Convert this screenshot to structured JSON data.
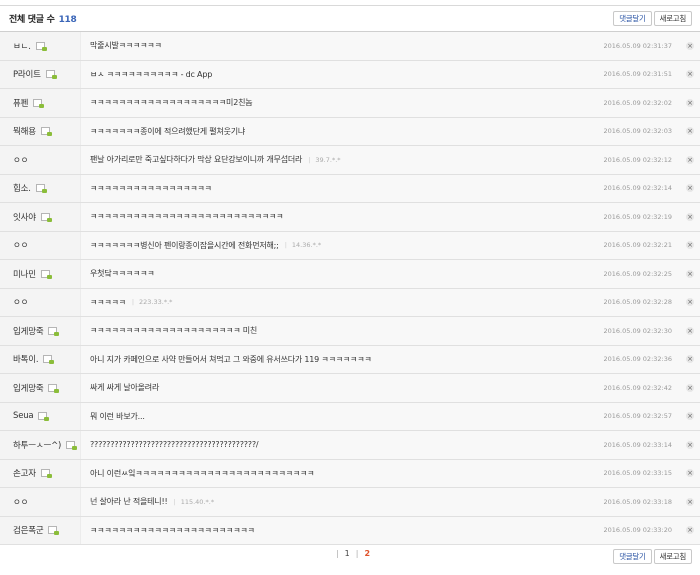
{
  "header": {
    "title": "전체 댓글 수",
    "count": "118",
    "write_button": "댓글달기",
    "refresh_button": "새로고침"
  },
  "comments": [
    {
      "nick": "ㅂㄴ.",
      "text": "막줄시발ㅋㅋㅋㅋㅋㅋ",
      "ip": "",
      "date": "2016.05.09 02:31:37"
    },
    {
      "nick": "P라이트",
      "text": "ㅂㅅ ㅋㅋㅋㅋㅋㅋㅋㅋㅋㅋ - dc App",
      "ip": "",
      "date": "2016.05.09 02:31:51"
    },
    {
      "nick": "퓨펜",
      "text": "ㅋㅋㅋㅋㅋㅋㅋㅋㅋㅋㅋㅋㅋㅋㅋㅋㅋㅋㅋ미2친놈",
      "ip": "",
      "date": "2016.05.09 02:32:02"
    },
    {
      "nick": "뭑해용",
      "text": "ㅋㅋㅋㅋㅋㅋㅋ종이에 적으려했단게 펼쳐웃기냐",
      "ip": "",
      "date": "2016.05.09 02:32:03"
    },
    {
      "nick": "ㅇㅇ",
      "text": "팬날 아가리로만 죽고싶다하다가 막상 요단강보이니까 개무섭더라",
      "ip": "39.7.*.*",
      "date": "2016.05.09 02:32:12"
    },
    {
      "nick": "힙소.",
      "text": "ㅋㅋㅋㅋㅋㅋㅋㅋㅋㅋㅋㅋㅋㅋㅋㅋㅋ",
      "ip": "",
      "date": "2016.05.09 02:32:14"
    },
    {
      "nick": "잇사야",
      "text": "ㅋㅋㅋㅋㅋㅋㅋㅋㅋㅋㅋㅋㅋㅋㅋㅋㅋㅋㅋㅋㅋㅋㅋㅋㅋㅋㅋ",
      "ip": "",
      "date": "2016.05.09 02:32:19"
    },
    {
      "nick": "ㅇㅇ",
      "text": "ㅋㅋㅋㅋㅋㅋㅋ병신아 펜이랑종이잡을시간에 전화먼저해;;",
      "ip": "14.36.*.*",
      "date": "2016.05.09 02:32:21"
    },
    {
      "nick": "미나민",
      "text": "우첫닼ㅋㅋㅋㅋㅋㅋ",
      "ip": "",
      "date": "2016.05.09 02:32:25"
    },
    {
      "nick": "ㅇㅇ",
      "text": "ㅋㅋㅋㅋㅋ",
      "ip": "223.33.*.*",
      "date": "2016.05.09 02:32:28"
    },
    {
      "nick": "입게망죽",
      "text": "ㅋㅋㅋㅋㅋㅋㅋㅋㅋㅋㅋㅋㅋㅋㅋㅋㅋㅋㅋㅋㅋ 미친",
      "ip": "",
      "date": "2016.05.09 02:32:30"
    },
    {
      "nick": "바톡이.",
      "text": "아니 지가 카페인으로 사약 만들어서 쳐먹고 그 와중에 유서쓰다가 119 ㅋㅋㅋㅋㅋㅋㅋ",
      "ip": "",
      "date": "2016.05.09 02:32:36"
    },
    {
      "nick": "입게망죽",
      "text": "싸게 싸게 날아올려라",
      "ip": "",
      "date": "2016.05.09 02:32:42"
    },
    {
      "nick": "Seua",
      "text": "뭐 이런 바보가...",
      "ip": "",
      "date": "2016.05.09 02:32:57"
    },
    {
      "nick": "하투ㅡㅅㅡ^)",
      "text": "?????????????????????????????????????????/",
      "ip": "",
      "date": "2016.05.09 02:33:14"
    },
    {
      "nick": "손고자",
      "text": "아니 이런ㅆ잌ㅋㅋㅋㅋㅋㅋㅋㅋㅋㅋㅋㅋㅋㅋㅋㅋㅋㅋㅋㅋㅋㅋㅋㅋㅋ",
      "ip": "",
      "date": "2016.05.09 02:33:15"
    },
    {
      "nick": "ㅇㅇ",
      "text": "넌 살아라 난 적을테니!!",
      "ip": "115.40.*.*",
      "date": "2016.05.09 02:33:18"
    },
    {
      "nick": "검은폭군",
      "text": "ㅋㅋㅋㅋㅋㅋㅋㅋㅋㅋㅋㅋㅋㅋㅋㅋㅋㅋㅋㅋㅋㅋㅋ",
      "ip": "",
      "date": "2016.05.09 02:33:20"
    }
  ],
  "delete_symbol": "×",
  "pagination": {
    "page1": "1",
    "page2": "2",
    "current": "2"
  },
  "footer": {
    "write_button": "댓글달기",
    "refresh_button": "새로고침"
  },
  "colors": {
    "count": "#3b66b8",
    "current_page": "#e0522a",
    "gallog_icon": "#8bbd3a"
  }
}
